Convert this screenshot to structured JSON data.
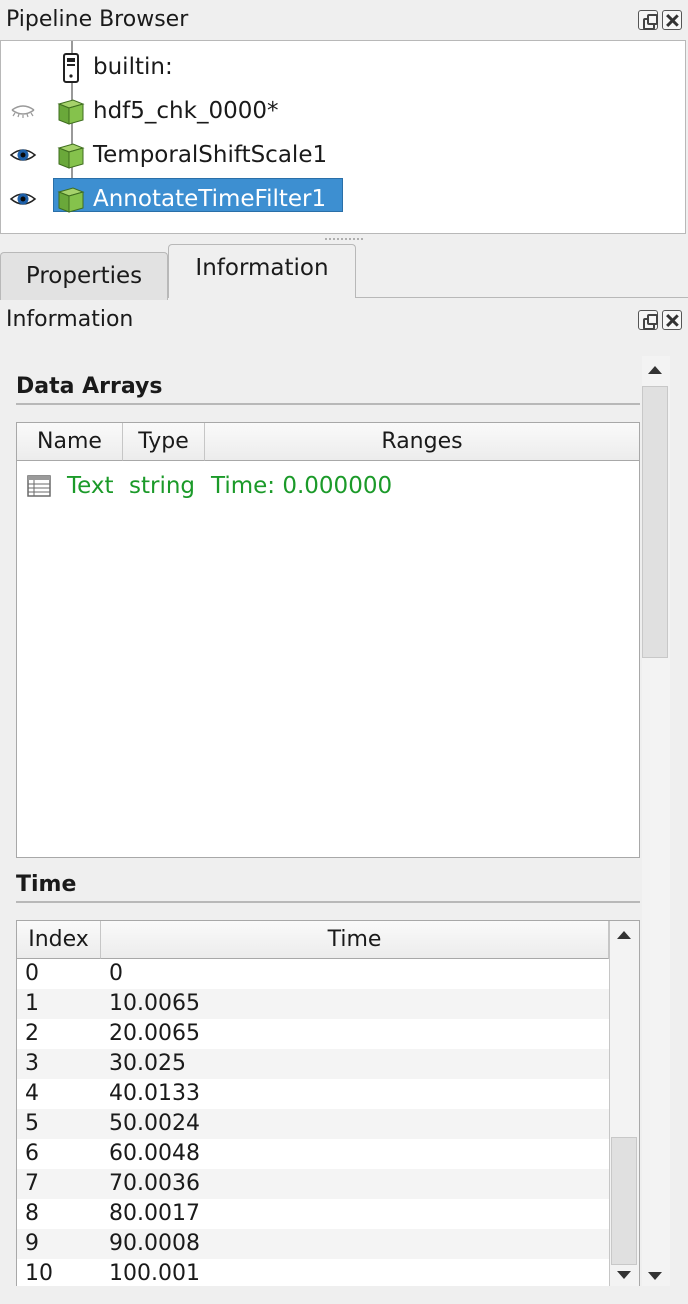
{
  "pipeline_browser": {
    "title": "Pipeline Browser",
    "items": [
      {
        "label": "builtin:",
        "icon": "server-icon",
        "visibility": "none"
      },
      {
        "label": "hdf5_chk_0000*",
        "icon": "green-cube-icon",
        "visibility": "hidden"
      },
      {
        "label": "TemporalShiftScale1",
        "icon": "green-cube-icon",
        "visibility": "visible"
      },
      {
        "label": "AnnotateTimeFilter1",
        "icon": "green-cube-icon",
        "visibility": "visible",
        "selected": true
      }
    ]
  },
  "tabs": [
    {
      "label": "Properties",
      "active": false
    },
    {
      "label": "Information",
      "active": true
    }
  ],
  "information": {
    "title": "Information",
    "data_arrays": {
      "title": "Data Arrays",
      "columns": [
        "Name",
        "Type",
        "Ranges"
      ],
      "rows": [
        {
          "icon": "table-icon",
          "name": "Text",
          "type": "string",
          "ranges": "Time: 0.000000"
        }
      ]
    },
    "time": {
      "title": "Time",
      "columns": [
        "Index",
        "Time"
      ],
      "rows": [
        {
          "index": "0",
          "time": "0"
        },
        {
          "index": "1",
          "time": "10.0065"
        },
        {
          "index": "2",
          "time": "20.0065"
        },
        {
          "index": "3",
          "time": "30.025"
        },
        {
          "index": "4",
          "time": "40.0133"
        },
        {
          "index": "5",
          "time": "50.0024"
        },
        {
          "index": "6",
          "time": "60.0048"
        },
        {
          "index": "7",
          "time": "70.0036"
        },
        {
          "index": "8",
          "time": "80.0017"
        },
        {
          "index": "9",
          "time": "90.0008"
        },
        {
          "index": "10",
          "time": "100.001"
        }
      ]
    }
  },
  "colors": {
    "selection": "#3d8fd1",
    "array_text": "#1b9a29",
    "cube": "#7cb84a"
  }
}
